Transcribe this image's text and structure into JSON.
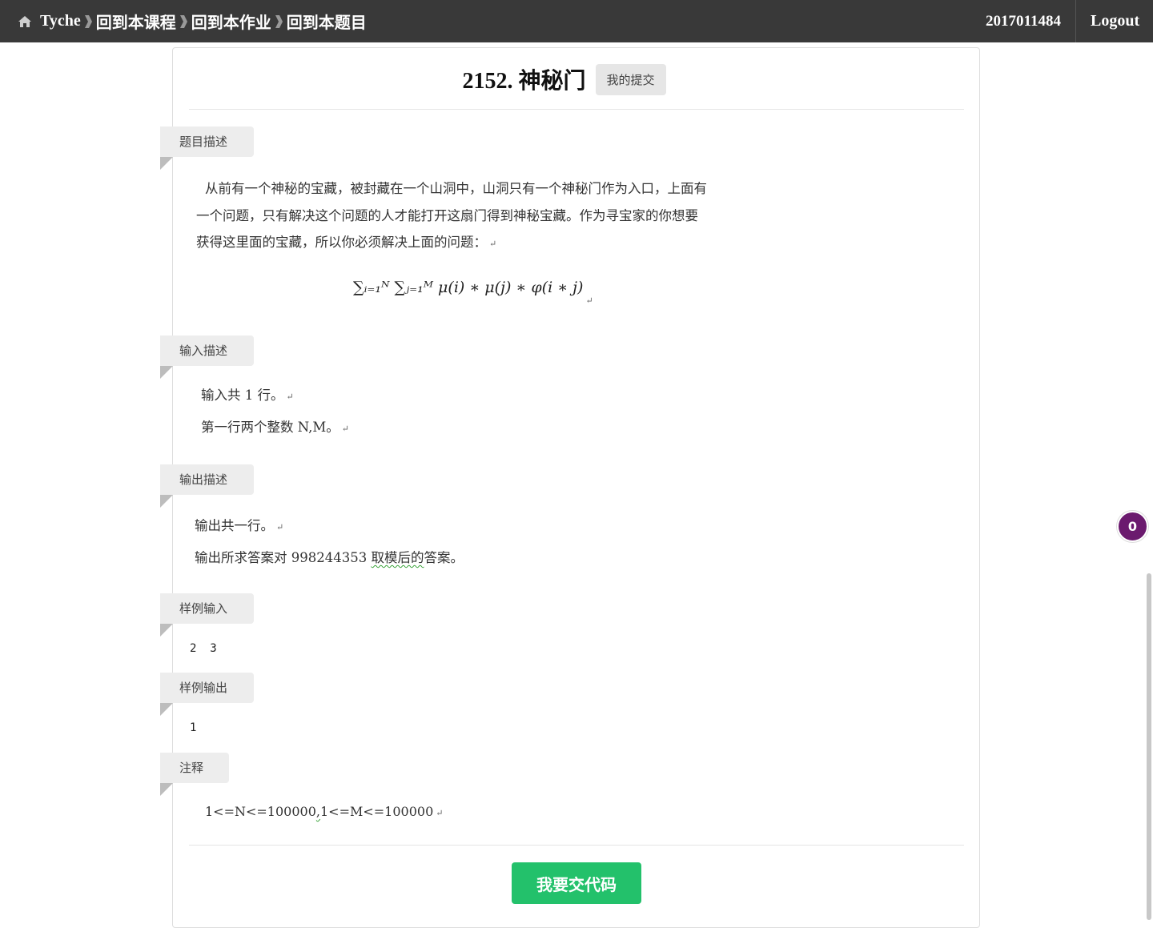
{
  "nav": {
    "brand": "Tyche",
    "crumbs": [
      "回到本课程",
      "回到本作业",
      "回到本题目"
    ],
    "user": "2017011484",
    "logout": "Logout"
  },
  "problem": {
    "title": "2152. 神秘门",
    "my_submissions": "我的提交"
  },
  "sections": {
    "description": {
      "label": "题目描述",
      "lines": [
        "从前有一个神秘的宝藏，被封藏在一个山洞中，山洞只有一个神秘门作为入口，上面有",
        "一个问题，只有解决这个问题的人才能打开这扇门得到神秘宝藏。作为寻宝家的你想要",
        "获得这里面的宝藏，所以你必须解决上面的问题："
      ],
      "formula": "∑ᵢ₌₁ᴺ ∑ⱼ₌₁ᴹ μ(i) ∗ μ(j) ∗ φ(i ∗ j)"
    },
    "input": {
      "label": "输入描述",
      "lines": [
        "输入共 1 行。",
        "第一行两个整数 N,M。"
      ]
    },
    "output": {
      "label": "输出描述",
      "lines": [
        "输出共一行。",
        "输出所求答案对 998244353",
        "取模后的",
        "答案。"
      ]
    },
    "sample_input": {
      "label": "样例输入",
      "value": "2  3"
    },
    "sample_output": {
      "label": "样例输出",
      "value": "1"
    },
    "notes": {
      "label": "注释",
      "value_a": "1<=N<=100000",
      "value_b": ",",
      "value_c": "1<=M<=100000"
    }
  },
  "submit_button": "我要交代码",
  "notification_count": "0",
  "return_mark": "↵"
}
